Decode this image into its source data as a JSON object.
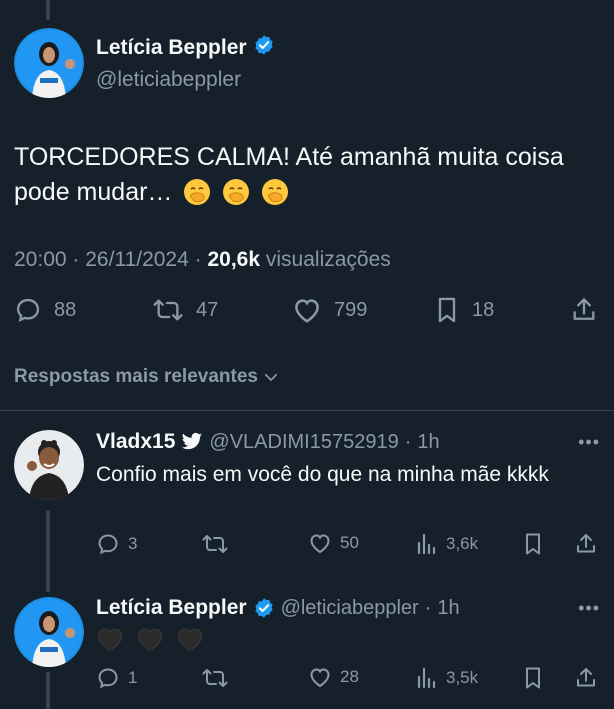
{
  "main_tweet": {
    "author_name": "Letícia Beppler",
    "author_handle": "@leticiabeppler",
    "text": "TORCEDORES CALMA! Até amanhã muita coisa pode mudar…",
    "emoji": [
      "face-with-hand-over-mouth",
      "face-with-hand-over-mouth",
      "face-with-hand-over-mouth"
    ],
    "time": "20:00",
    "date": "26/11/2024",
    "views_count": "20,6k",
    "views_label": "visualizações",
    "replies": "88",
    "retweets": "47",
    "likes": "799",
    "bookmarks": "18"
  },
  "sort": {
    "label": "Respostas mais relevantes"
  },
  "replies": [
    {
      "author_name": "Vladx15",
      "author_handle": "@VLADIMI15752919",
      "time": "1h",
      "text": "Confio mais em você do que na minha mãe kkkk",
      "replies": "3",
      "retweets": "",
      "likes": "50",
      "views": "3,6k"
    },
    {
      "author_name": "Letícia Beppler",
      "author_handle": "@leticiabeppler",
      "time": "1h",
      "text": "",
      "emoji": [
        "black-heart",
        "black-heart",
        "black-heart"
      ],
      "replies": "1",
      "retweets": "",
      "likes": "28",
      "views": "3,5k"
    }
  ],
  "colors": {
    "background": "#15202b",
    "text": "#f7f9f9",
    "muted": "#8b98a5",
    "verified": "#1d9bf0",
    "divider": "#38444d"
  }
}
